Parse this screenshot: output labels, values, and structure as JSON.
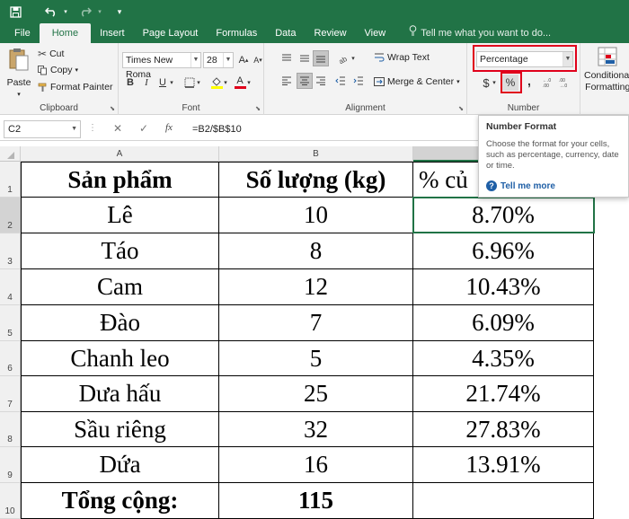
{
  "tabs": [
    "File",
    "Home",
    "Insert",
    "Page Layout",
    "Formulas",
    "Data",
    "Review",
    "View"
  ],
  "tell_me": "Tell me what you want to do...",
  "clipboard": {
    "paste": "Paste",
    "cut": "Cut",
    "copy": "Copy",
    "format_painter": "Format Painter",
    "label": "Clipboard"
  },
  "font": {
    "name": "Times New Roma",
    "size": "28",
    "label": "Font"
  },
  "alignment": {
    "wrap_text": "Wrap Text",
    "merge_center": "Merge & Center",
    "label": "Alignment"
  },
  "number": {
    "format": "Percentage",
    "currency": "$",
    "percent": "%",
    "comma": ",",
    "label": "Number"
  },
  "styles": {
    "conditional": "Conditional",
    "formatting": "Formatting"
  },
  "formula_bar": {
    "name_box": "C2",
    "formula": "=B2/$B$10"
  },
  "tooltip": {
    "title": "Number Format",
    "description": "Choose the format for your cells, such as percentage, currency, date or time.",
    "more": "Tell me more"
  },
  "columns": [
    "A",
    "B"
  ],
  "row_numbers": [
    "1",
    "2",
    "3",
    "4",
    "5",
    "6",
    "7",
    "8",
    "9",
    "10"
  ],
  "rows": [
    [
      "Sản phẩm",
      "Số lượng (kg)",
      "% củ"
    ],
    [
      "Lê",
      "10",
      "8.70%"
    ],
    [
      "Táo",
      "8",
      "6.96%"
    ],
    [
      "Cam",
      "12",
      "10.43%"
    ],
    [
      "Đào",
      "7",
      "6.09%"
    ],
    [
      "Chanh leo",
      "5",
      "4.35%"
    ],
    [
      "Dưa hấu",
      "25",
      "21.74%"
    ],
    [
      "Sầu riêng",
      "32",
      "27.83%"
    ],
    [
      "Dứa",
      "16",
      "13.91%"
    ],
    [
      "Tổng cộng:",
      "115",
      ""
    ]
  ],
  "colors": {
    "excel_green": "#217346",
    "highlight_red": "#e0001b",
    "link_blue": "#1f5fa6"
  }
}
